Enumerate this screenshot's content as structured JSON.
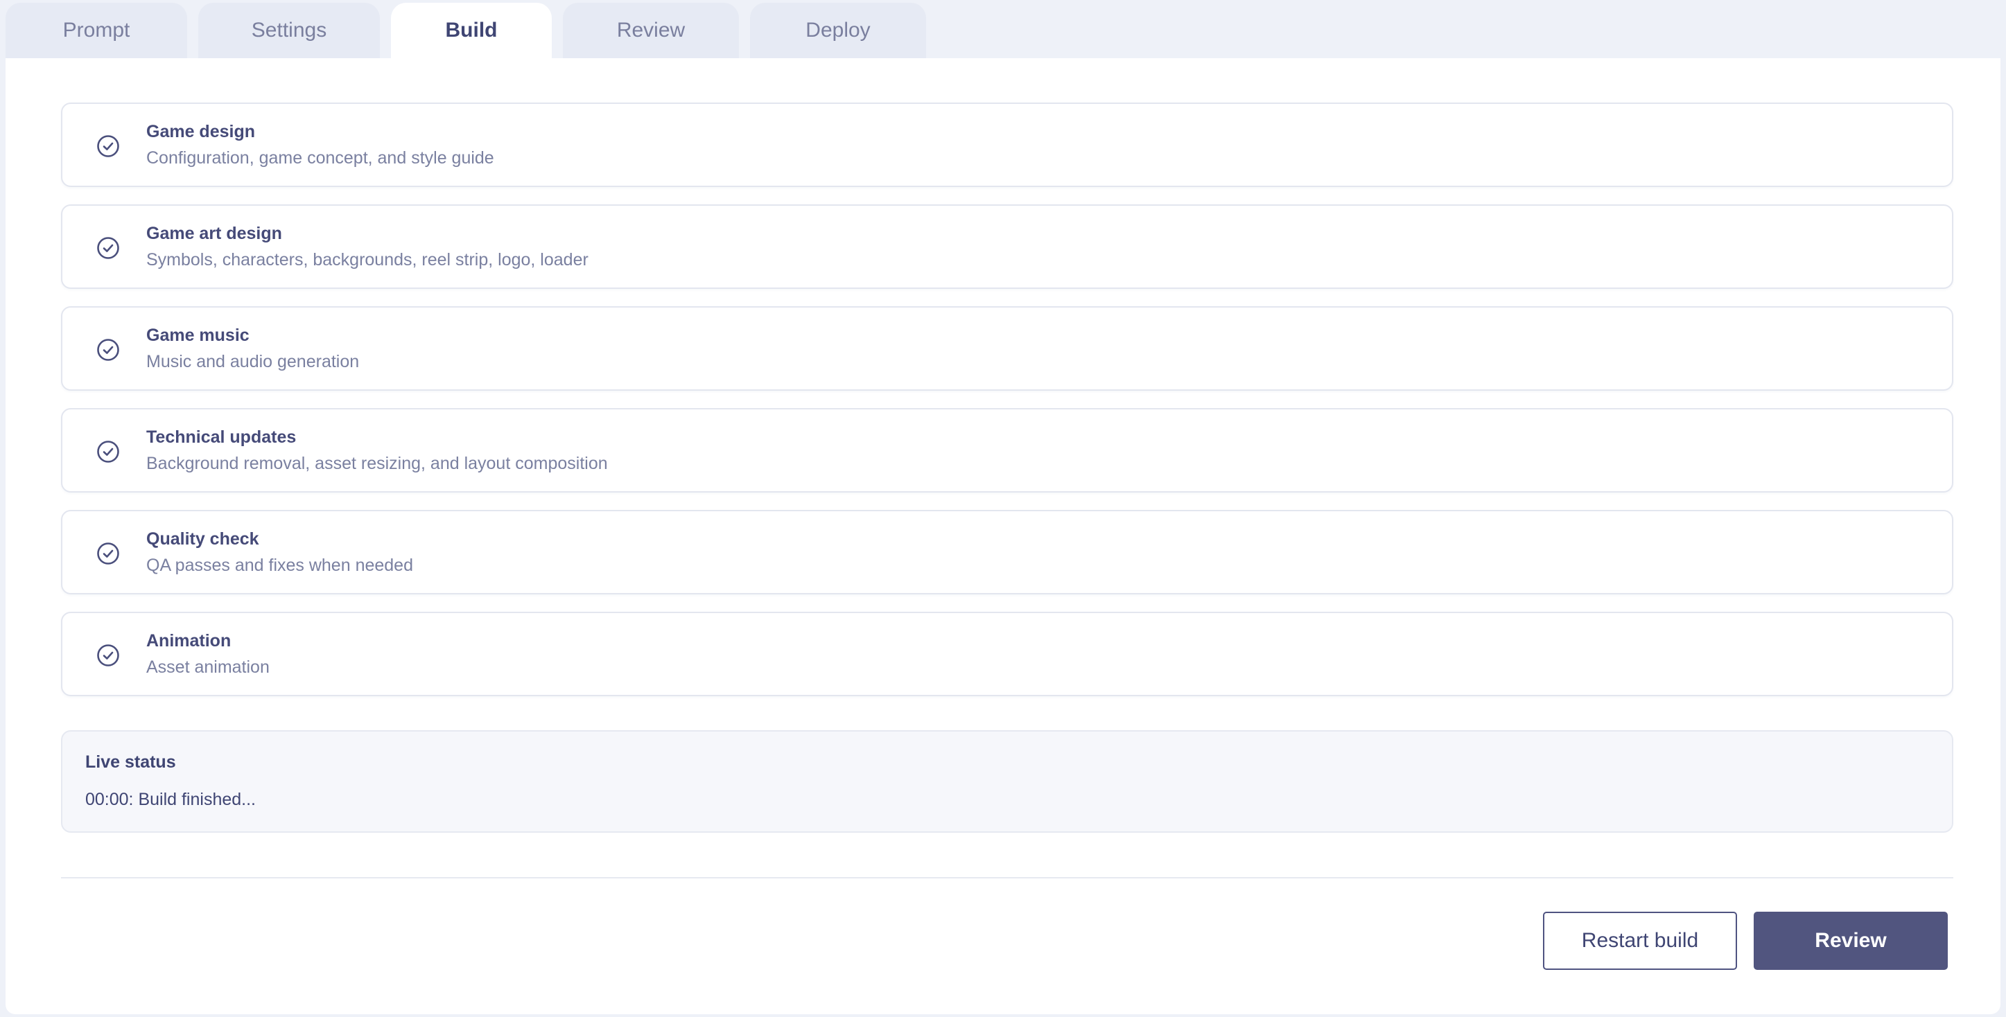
{
  "tabs": [
    {
      "label": "Prompt",
      "active": false
    },
    {
      "label": "Settings",
      "active": false
    },
    {
      "label": "Build",
      "active": true
    },
    {
      "label": "Review",
      "active": false
    },
    {
      "label": "Deploy",
      "active": false
    }
  ],
  "steps": [
    {
      "title": "Game design",
      "description": "Configuration, game concept, and style guide",
      "status": "complete",
      "icon": "check-circle-icon"
    },
    {
      "title": "Game art design",
      "description": "Symbols, characters, backgrounds, reel strip, logo, loader",
      "status": "complete",
      "icon": "check-circle-icon"
    },
    {
      "title": "Game music",
      "description": "Music and audio generation",
      "status": "complete",
      "icon": "check-circle-icon"
    },
    {
      "title": "Technical updates",
      "description": "Background removal, asset resizing, and layout composition",
      "status": "complete",
      "icon": "check-circle-icon"
    },
    {
      "title": "Quality check",
      "description": "QA passes and fixes when needed",
      "status": "complete",
      "icon": "check-circle-icon"
    },
    {
      "title": "Animation",
      "description": "Asset animation",
      "status": "complete",
      "icon": "check-circle-icon"
    }
  ],
  "live_status": {
    "title": "Live status",
    "message": "00:00: Build finished..."
  },
  "actions": {
    "restart_label": "Restart build",
    "review_label": "Review"
  },
  "colors": {
    "accent": "#51557f",
    "page_background": "#eef1f8",
    "inactive_tab": "#e6eaf4"
  }
}
